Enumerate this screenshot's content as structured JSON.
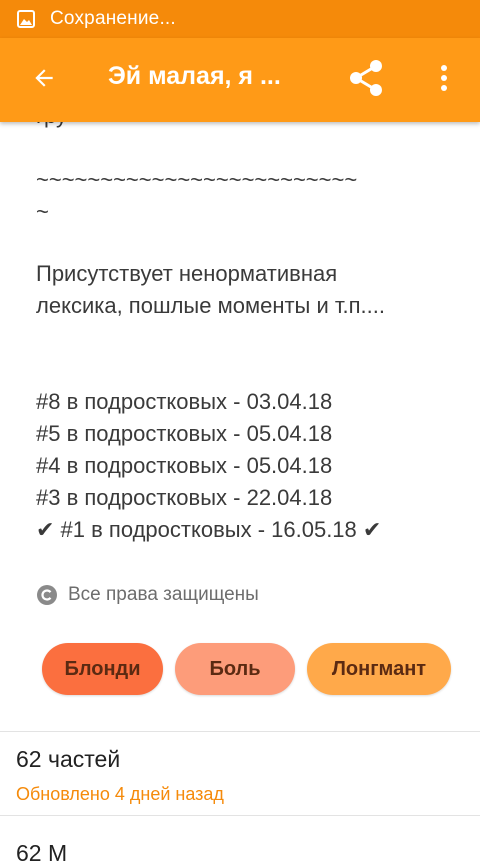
{
  "status_bar": {
    "icon": "image-icon",
    "text": "Сохранение..."
  },
  "app_bar": {
    "title": "Эй малая, я ...",
    "back_icon": "arrow-back-icon",
    "share_icon": "share-icon",
    "more_icon": "more-vert-icon"
  },
  "description": {
    "partial_top": "гру",
    "tilde_line_1": "~~~~~~~~~~~~~~~~~~~~~~~~~",
    "tilde_line_2": "~",
    "warning_line_1": "Присутствует ненормативная",
    "warning_line_2": "лексика, пошлые моменты и т.п....",
    "rankings": [
      "#8 в подростковых - 03.04.18",
      "#5 в подростковых - 05.04.18",
      "#4 в подростковых - 05.04.18",
      "#3 в подростковых - 22.04.18",
      "✔ #1 в подростковых - 16.05.18 ✔"
    ]
  },
  "copyright": {
    "icon": "copyright-icon",
    "text": "Все права защищены"
  },
  "tags": [
    {
      "label": "Блонди",
      "color": "#fb6f3f"
    },
    {
      "label": "Боль",
      "color": "#fd9c7a"
    },
    {
      "label": "Лонгмант",
      "color": "#ffa94a"
    }
  ],
  "parts": {
    "count": "62 частей",
    "updated": "Обновлено 4 дней назад"
  },
  "partial_bottom": "62 М",
  "colors": {
    "status_bar": "#f58a0a",
    "app_bar": "#ff9a17",
    "accent": "#f58a0a"
  }
}
